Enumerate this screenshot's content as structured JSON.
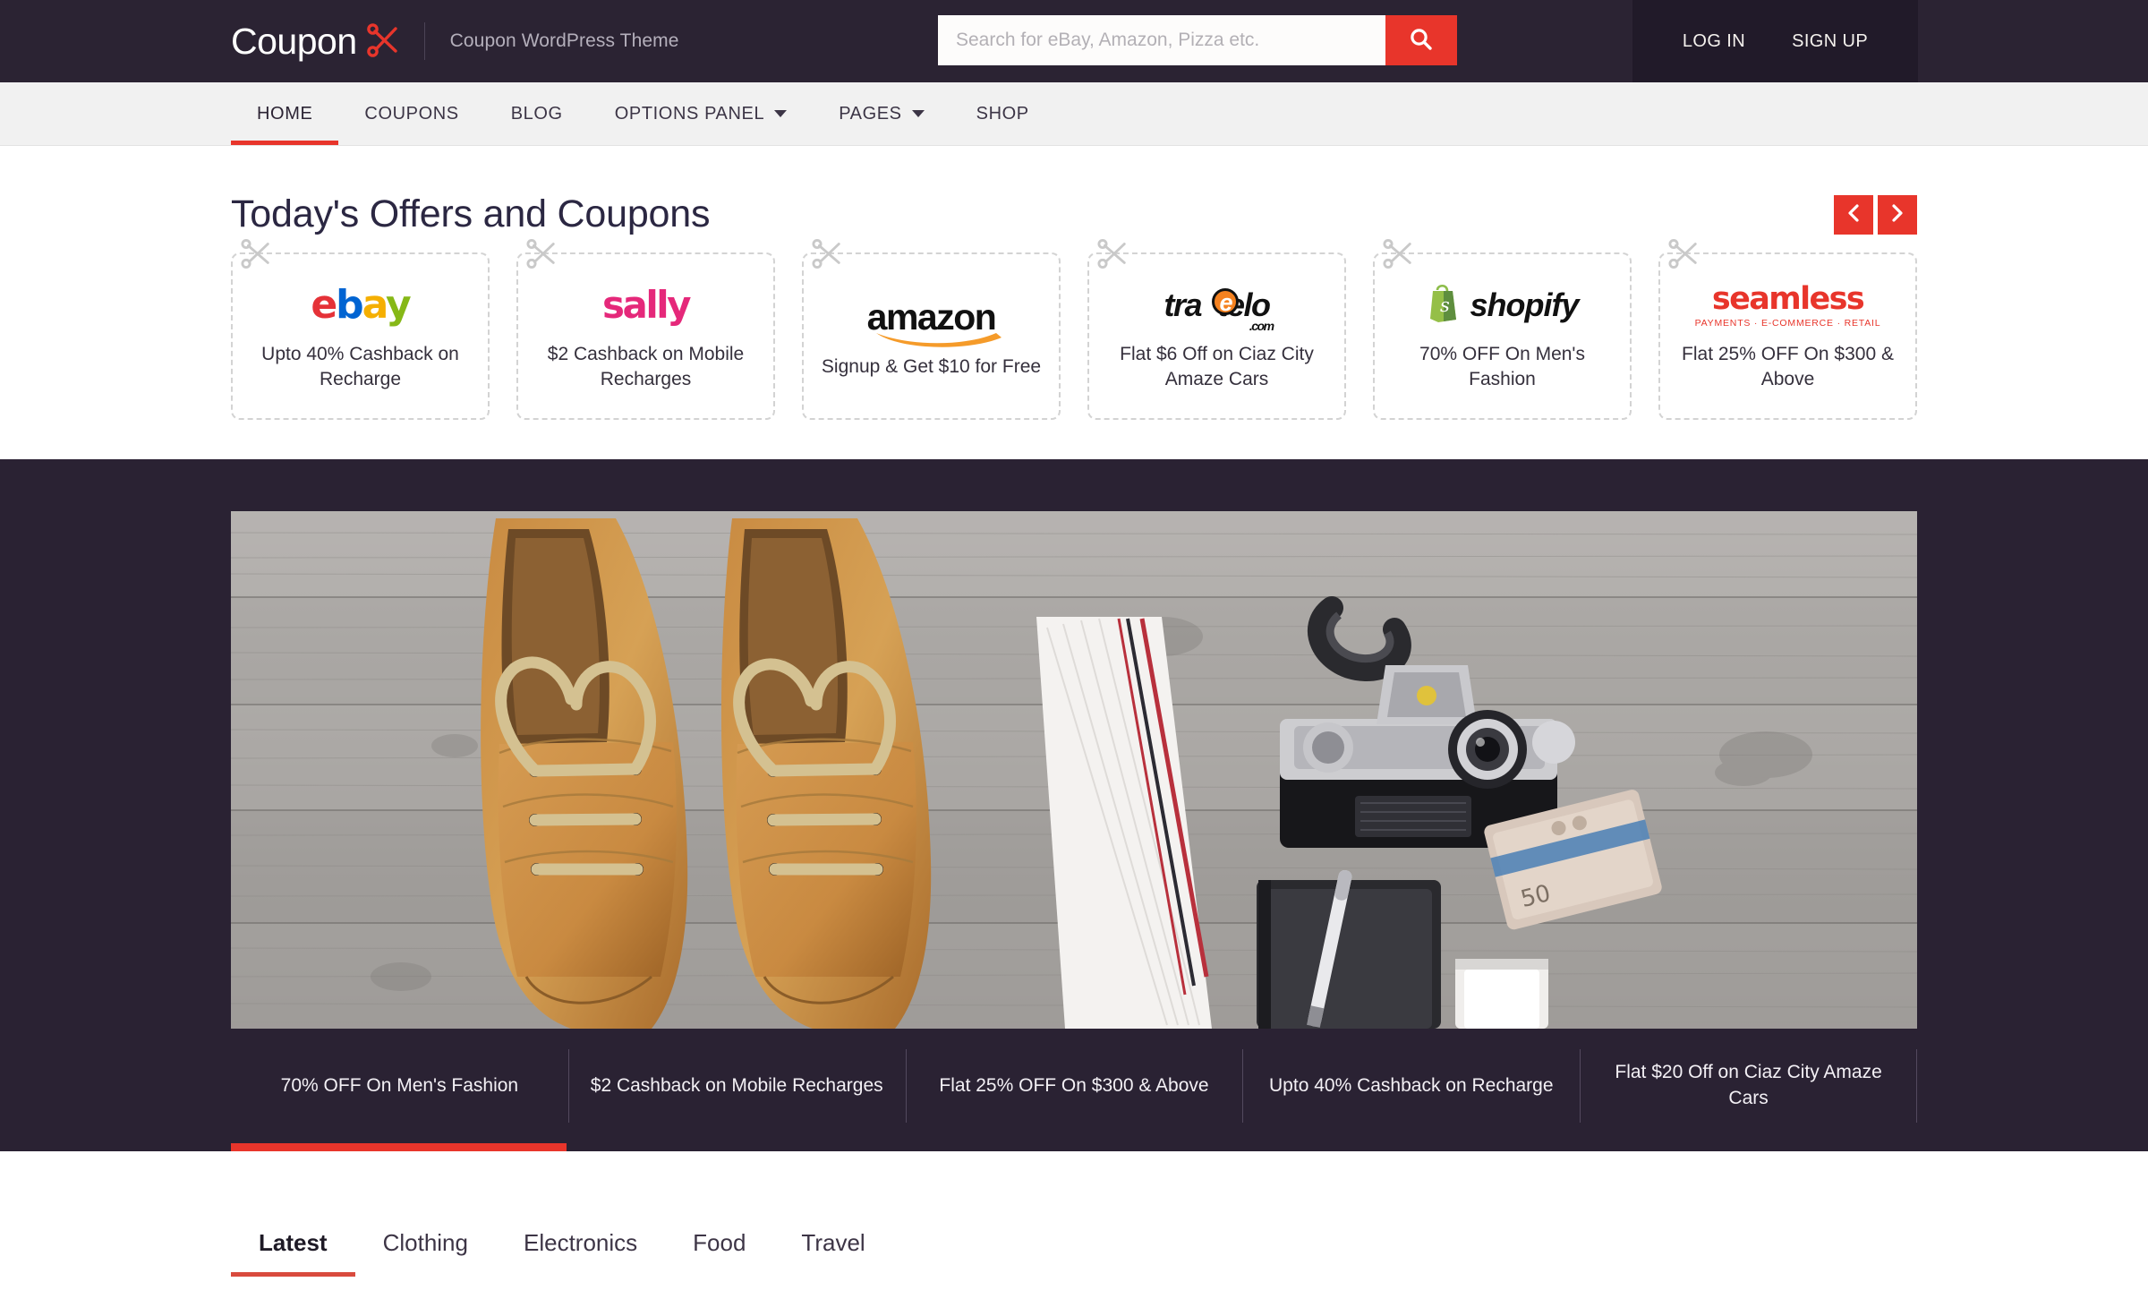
{
  "header": {
    "logo_text": "Coupon",
    "logo_icon": "scissors-icon",
    "tagline": "Coupon WordPress Theme",
    "search": {
      "placeholder": "Search for eBay, Amazon, Pizza etc.",
      "value": "",
      "icon": "search-icon"
    },
    "login_label": "LOG IN",
    "signup_label": "SIGN UP",
    "bg_color": "#2b2333",
    "accent_color": "#e8352b"
  },
  "nav": {
    "items": [
      {
        "label": "HOME",
        "active": true,
        "has_dropdown": false
      },
      {
        "label": "COUPONS",
        "active": false,
        "has_dropdown": false
      },
      {
        "label": "BLOG",
        "active": false,
        "has_dropdown": false
      },
      {
        "label": "OPTIONS PANEL",
        "active": false,
        "has_dropdown": true
      },
      {
        "label": "PAGES",
        "active": false,
        "has_dropdown": true
      },
      {
        "label": "SHOP",
        "active": false,
        "has_dropdown": false
      }
    ]
  },
  "offers": {
    "title": "Today's Offers and Coupons",
    "prev_icon": "chevron-left-icon",
    "next_icon": "chevron-right-icon",
    "cards": [
      {
        "brand": "ebay",
        "desc": "Upto 40% Cashback on Recharge"
      },
      {
        "brand": "sally",
        "desc": "$2 Cashback on Mobile Recharges"
      },
      {
        "brand": "amazon",
        "desc": "Signup & Get $10 for Free"
      },
      {
        "brand": "traetelo",
        "desc": "Flat $6 Off on Ciaz City Amaze Cars"
      },
      {
        "brand": "shopify",
        "desc": "70% OFF On Men's Fashion"
      },
      {
        "brand": "seamless",
        "desc": "Flat 25% OFF On $300 & Above"
      }
    ],
    "brand_labels": {
      "ebay_e": "e",
      "ebay_b": "b",
      "ebay_a": "a",
      "ebay_y": "y",
      "sally": "sally",
      "amazon": "amazon",
      "traetelo_pre": "tra",
      "traetelo_e": "e",
      "traetelo_post": "telo",
      "traetelo_com": ".com",
      "shopify": "shopify",
      "seamless": "seamless",
      "seamless_sub": "PAYMENTS · E-COMMERCE · RETAIL"
    }
  },
  "hero": {
    "image_alt": "flat-lay of brown leather shoes, striped tie, vintage camera, notebook, pen and banknotes on weathered grey wood",
    "bg_color": "#2a2233",
    "captions": [
      "70% OFF On Men's Fashion",
      "$2 Cashback on Mobile Recharges",
      "Flat 25% OFF On $300 & Above",
      "Upto 40% Cashback on Recharge",
      "Flat $20 Off on Ciaz City Amaze Cars"
    ]
  },
  "category_tabs": {
    "items": [
      {
        "label": "Latest",
        "active": true
      },
      {
        "label": "Clothing",
        "active": false
      },
      {
        "label": "Electronics",
        "active": false
      },
      {
        "label": "Food",
        "active": false
      },
      {
        "label": "Travel",
        "active": false
      }
    ]
  }
}
